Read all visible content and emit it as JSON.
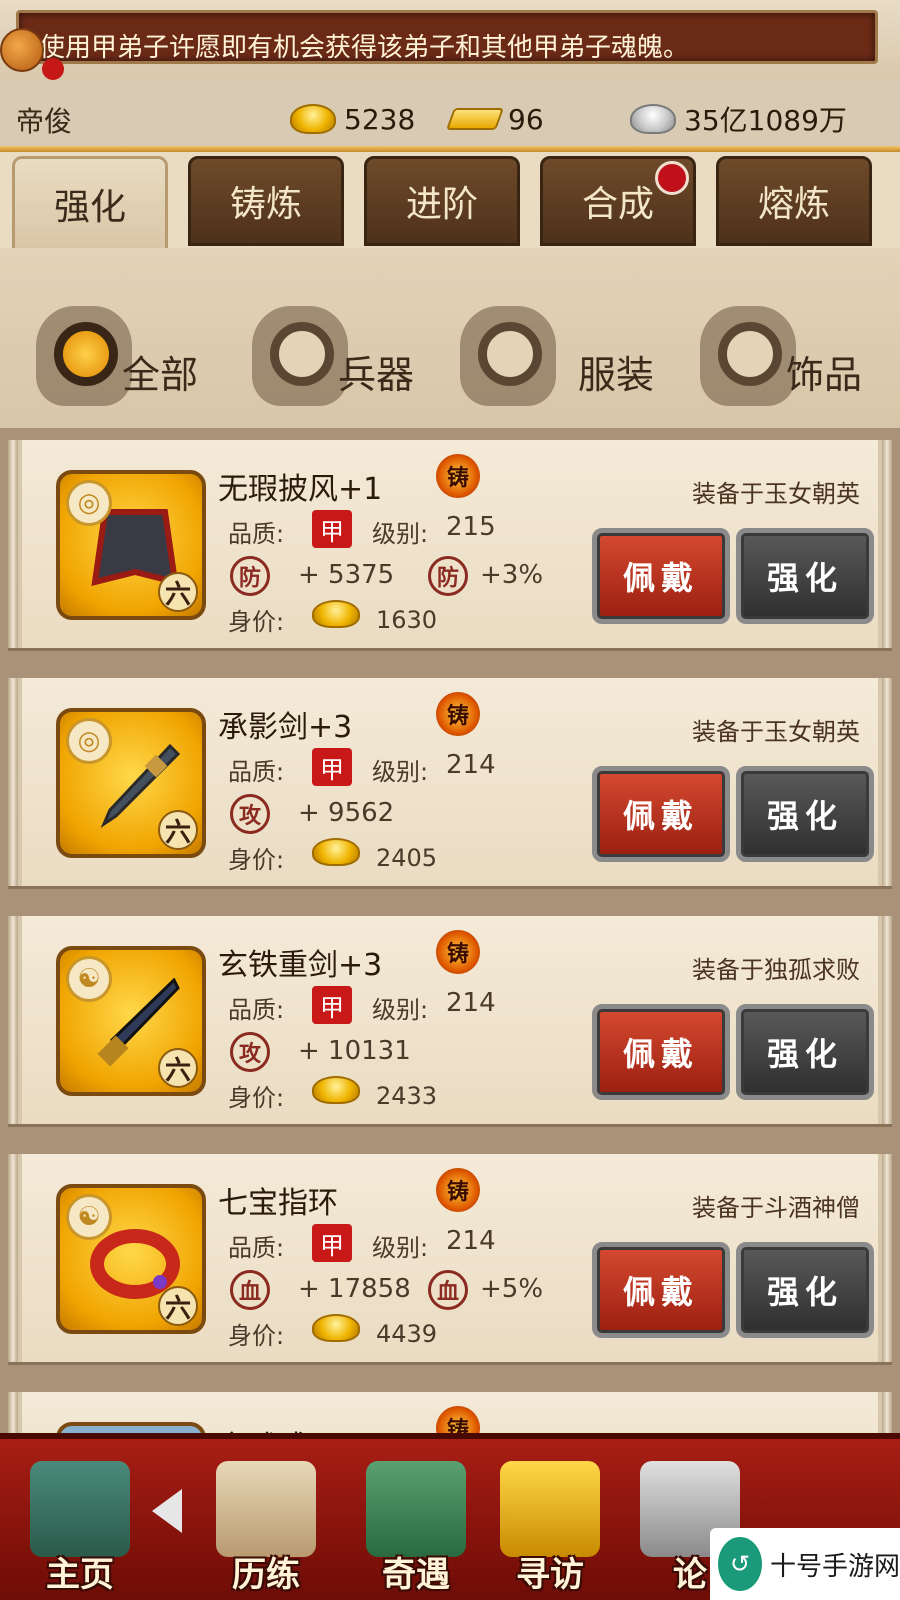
{
  "marquee": {
    "text": "使用甲弟子许愿即有机会获得该弟子和其他甲弟子魂魄。"
  },
  "player": {
    "name": "帝俊"
  },
  "resources": {
    "gold": "5238",
    "gold_bar": "96",
    "silver": "35亿1089万"
  },
  "tabs": [
    {
      "label": "强化",
      "active": true
    },
    {
      "label": "铸炼"
    },
    {
      "label": "进阶"
    },
    {
      "label": "合成",
      "badge": true
    },
    {
      "label": "熔炼"
    }
  ],
  "categories": [
    {
      "label": "全部",
      "active": true
    },
    {
      "label": "兵器"
    },
    {
      "label": "服装"
    },
    {
      "label": "饰品"
    }
  ],
  "labels": {
    "quality": "品质:",
    "level": "级别:",
    "price": "身价:",
    "wear": "佩戴",
    "upgrade": "强化",
    "cast": "铸",
    "rank": "六",
    "quality_seal": "甲"
  },
  "items": [
    {
      "name": "无瑕披风+1",
      "equipped": "装备于玉女朝英",
      "level": "215",
      "stat_icon": "防",
      "stat": "+ 5375",
      "bonus": "+3%",
      "price": "1630",
      "emblem": "fire-emblem-icon"
    },
    {
      "name": "承影剑+3",
      "equipped": "装备于玉女朝英",
      "level": "214",
      "stat_icon": "攻",
      "stat": "+ 9562",
      "bonus": "",
      "price": "2405",
      "emblem": "fire-emblem-icon"
    },
    {
      "name": "玄铁重剑+3",
      "equipped": "装备于独孤求败",
      "level": "214",
      "stat_icon": "攻",
      "stat": "+ 10131",
      "bonus": "",
      "price": "2433",
      "emblem": "yin-yang-icon"
    },
    {
      "name": "七宝指环",
      "equipped": "装备于斗酒神僧",
      "level": "214",
      "stat_icon": "血",
      "stat": "+ 17858",
      "bonus": "+5%",
      "price": "4439",
      "emblem": "yin-yang-icon"
    }
  ],
  "partial_item": {
    "name": "玄武戒"
  },
  "bottom_nav": [
    {
      "label": "主页"
    },
    {
      "label": "历练"
    },
    {
      "label": "奇遇"
    },
    {
      "label": "寻访"
    },
    {
      "label": "论"
    }
  ],
  "watermark": {
    "text": "十号手游网"
  },
  "colors": {
    "wear_button": "#c0341e",
    "upgrade_button": "#3e3e3e",
    "tab_active": "#e3d3b6",
    "tab_inactive": "#5c3c22",
    "nav_background": "#8e1509"
  }
}
